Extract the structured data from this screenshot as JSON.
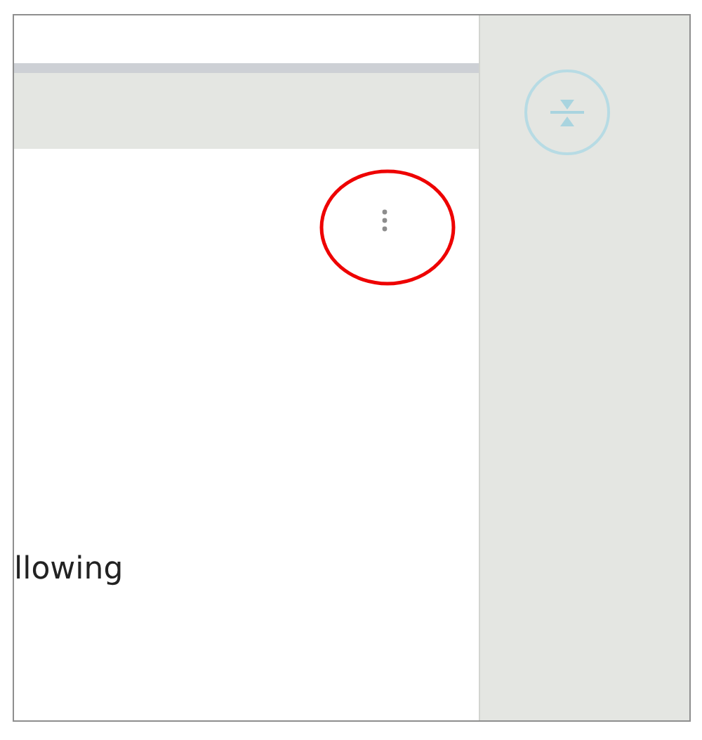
{
  "card": {
    "text": "llowing"
  }
}
